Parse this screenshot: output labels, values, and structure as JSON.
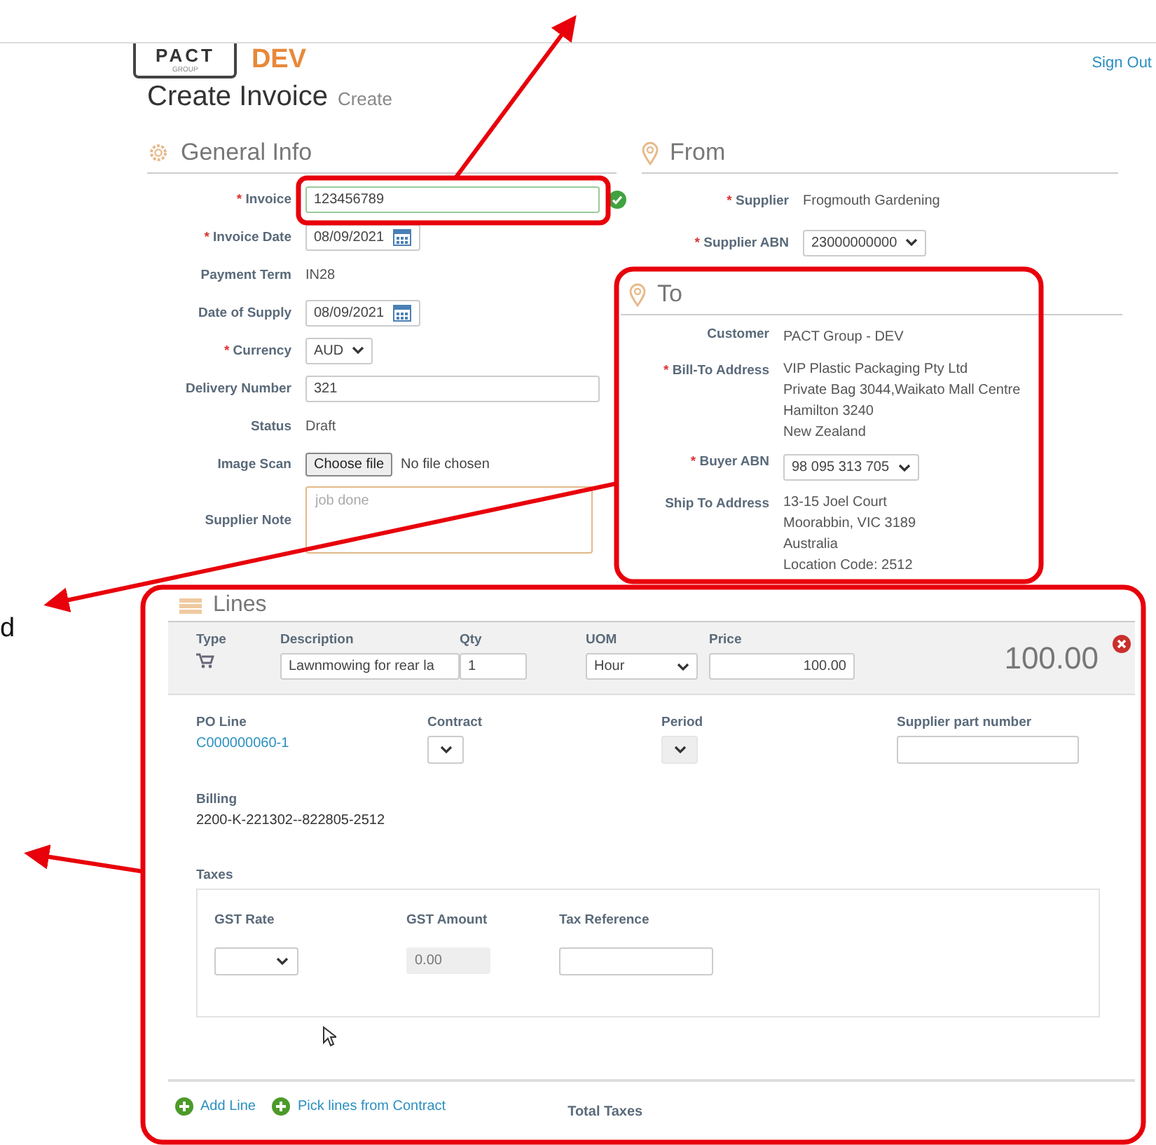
{
  "header": {
    "logo": "PACT",
    "logo_sub": "GROUP",
    "env": "DEV",
    "sign_out": "Sign Out"
  },
  "page": {
    "title": "Create Invoice",
    "subtitle": "Create"
  },
  "general_info": {
    "title": "General Info",
    "fields": [
      {
        "marker": "*",
        "label": "Invoice",
        "kind": "input",
        "value": "123456789",
        "valid": true
      },
      {
        "marker": "*",
        "label": "Invoice Date",
        "kind": "date",
        "value": "08/09/2021"
      },
      {
        "label": "Payment Term",
        "kind": "text",
        "value": "IN28"
      },
      {
        "label": "Date of Supply",
        "kind": "date",
        "value": "08/09/2021"
      },
      {
        "marker": "*",
        "label": "Currency",
        "kind": "select",
        "value": "AUD"
      },
      {
        "label": "Delivery Number",
        "kind": "input",
        "value": "321"
      },
      {
        "label": "Status",
        "kind": "text",
        "value": "Draft"
      },
      {
        "label": "Image Scan",
        "kind": "file",
        "button": "Choose file",
        "value": "No file chosen"
      },
      {
        "label": "Supplier Note",
        "kind": "textarea",
        "placeholder": "job done"
      }
    ]
  },
  "from": {
    "title": "From",
    "fields": [
      {
        "marker": "*",
        "label": "Supplier",
        "kind": "text",
        "value": "Frogmouth Gardening"
      },
      {
        "marker": "*",
        "label": "Supplier ABN",
        "kind": "select",
        "value": "23000000000"
      }
    ]
  },
  "to": {
    "title": "To",
    "fields": [
      {
        "label": "Customer",
        "kind": "text",
        "value": "PACT Group - DEV"
      },
      {
        "marker": "*",
        "label": "Bill-To Address",
        "kind": "multiline",
        "lines": [
          "VIP Plastic Packaging Pty Ltd",
          "Private Bag 3044,Waikato Mall Centre",
          "Hamilton 3240",
          "New Zealand"
        ]
      },
      {
        "marker": "*",
        "label": "Buyer ABN",
        "kind": "select",
        "value": "98 095 313 705"
      },
      {
        "label": "Ship To Address",
        "kind": "multiline",
        "lines": [
          "13-15 Joel Court",
          "Moorabbin, VIC 3189",
          "Australia",
          "Location Code: 2512"
        ]
      }
    ]
  },
  "lines": {
    "title": "Lines",
    "line_item": {
      "type_label": "Type",
      "description_label": "Description",
      "description": "Lawnmowing for rear la",
      "qty_label": "Qty",
      "qty": "1",
      "uom_label": "UOM",
      "uom": "Hour",
      "price_label": "Price",
      "price": "100.00",
      "total": "100.00"
    },
    "details": {
      "po_line_label": "PO Line",
      "po_line": "C000000060-1",
      "contract_label": "Contract",
      "period_label": "Period",
      "period_disabled": true,
      "supplier_part_label": "Supplier part number",
      "billing_label": "Billing",
      "billing": "2200-K-221302--822805-2512"
    },
    "taxes": {
      "title": "Taxes",
      "gst_rate_label": "GST Rate",
      "gst_amount_label": "GST Amount",
      "gst_amount": "0.00",
      "tax_reference_label": "Tax Reference"
    },
    "footer": {
      "actions": [
        "Add Line",
        "Pick lines from Contract"
      ],
      "total_taxes_label": "Total Taxes"
    }
  },
  "annotation": {
    "fragment": "d"
  }
}
